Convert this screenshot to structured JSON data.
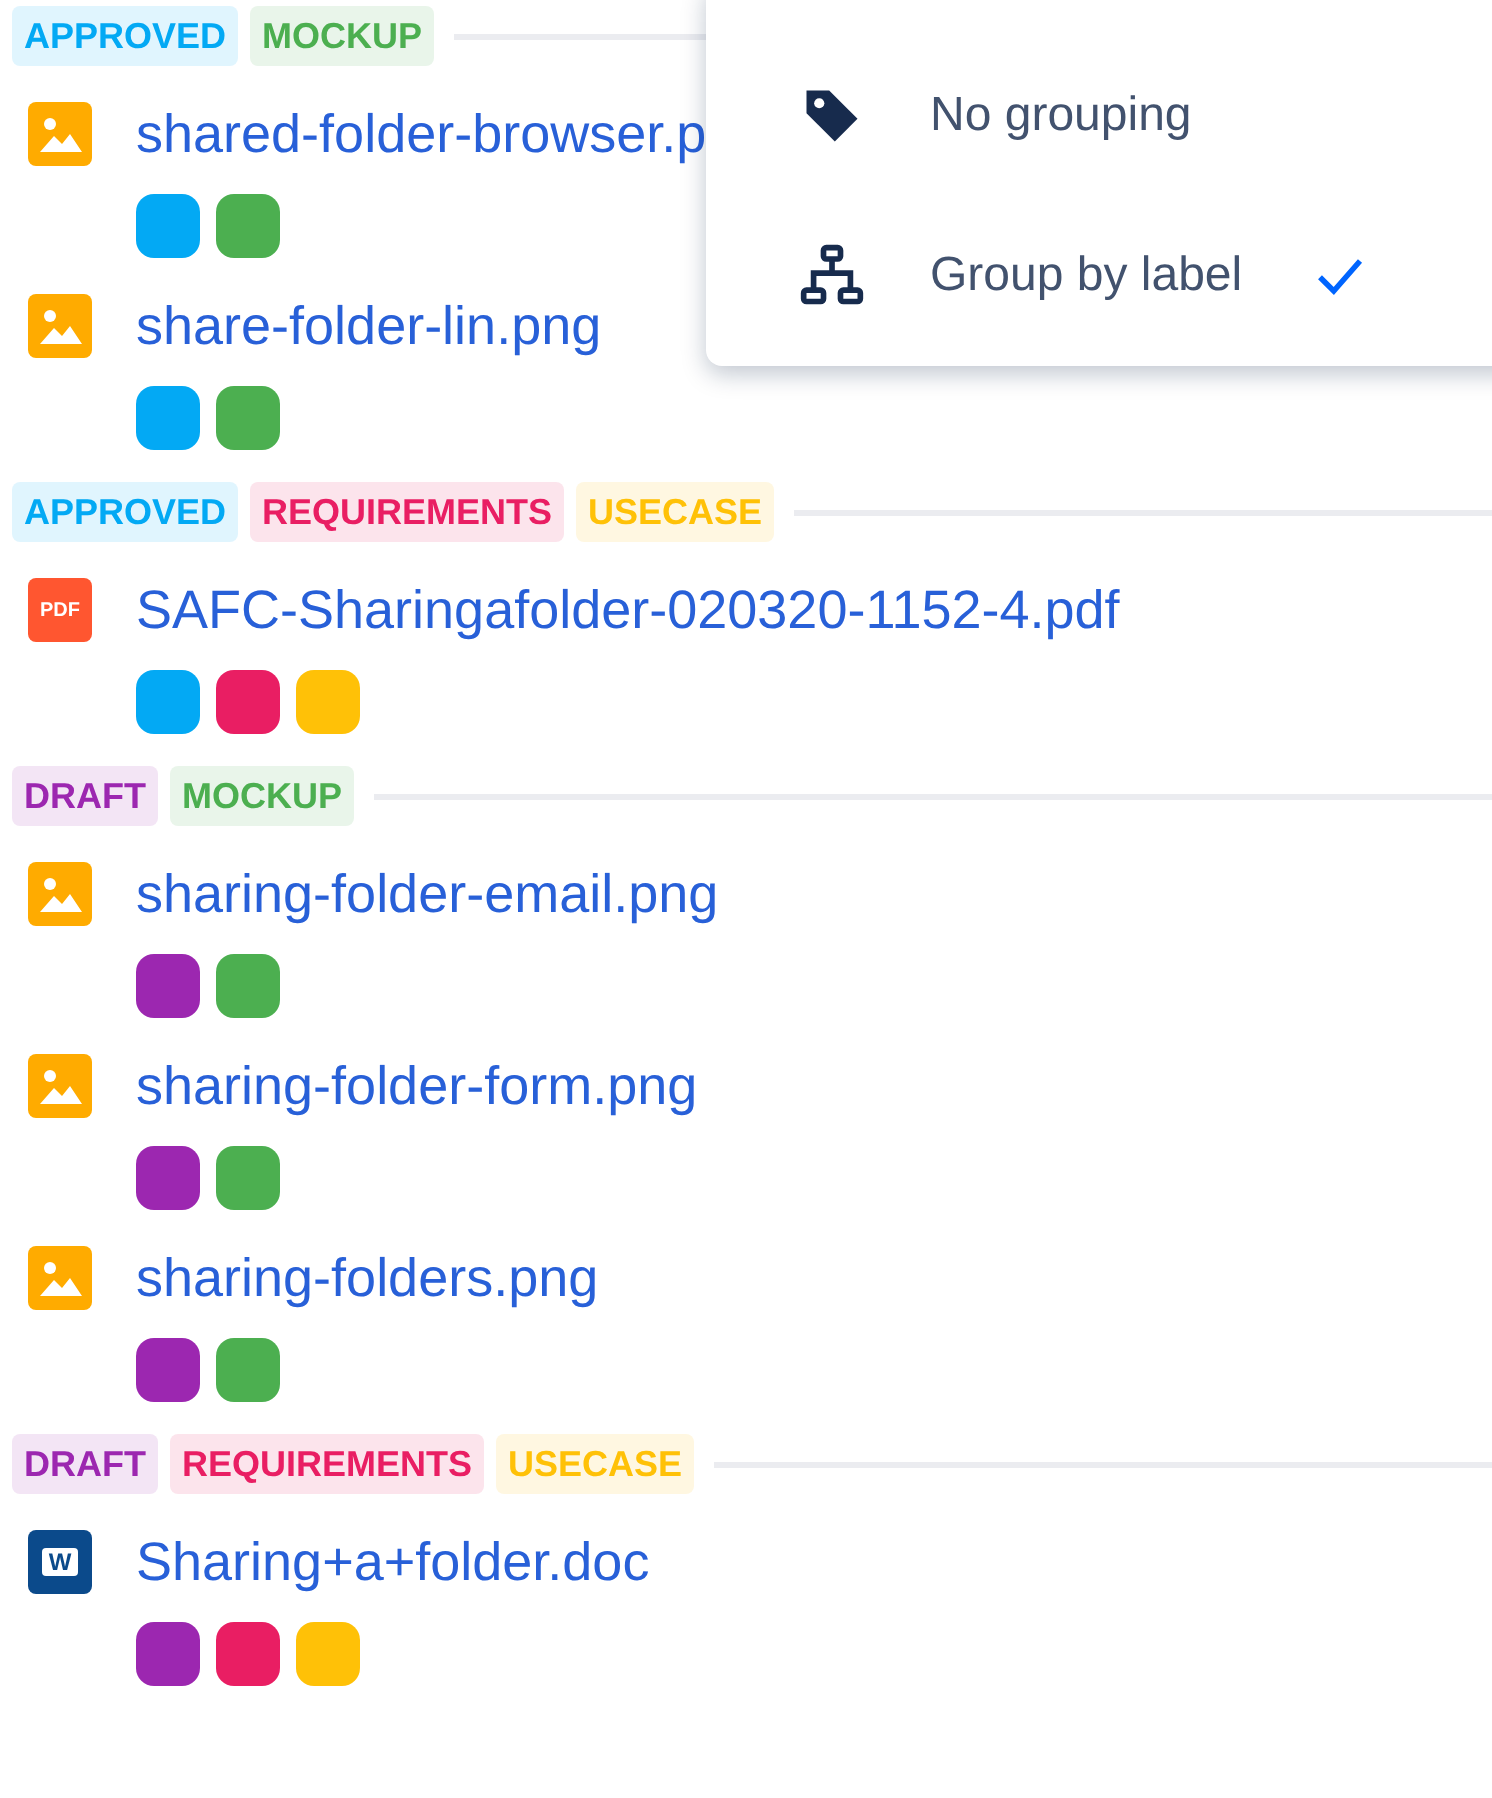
{
  "groups": [
    {
      "labels": [
        {
          "text": "APPROVED",
          "color": "#03a9f4"
        },
        {
          "text": "MOCKUP",
          "color": "#4caf50"
        }
      ],
      "files": [
        {
          "kind": "image",
          "name": "shared-folder-browser.p",
          "tags": [
            {
              "color": "#03a9f4"
            },
            {
              "color": "#4caf50"
            }
          ]
        },
        {
          "kind": "image",
          "name": "share-folder-lin.png",
          "tags": [
            {
              "color": "#03a9f4"
            },
            {
              "color": "#4caf50"
            }
          ]
        }
      ]
    },
    {
      "labels": [
        {
          "text": "APPROVED",
          "color": "#03a9f4"
        },
        {
          "text": "REQUIREMENTS",
          "color": "#e91e63"
        },
        {
          "text": "USECASE",
          "color": "#ffc107"
        }
      ],
      "files": [
        {
          "kind": "pdf",
          "icon_text": "PDF",
          "name": "SAFC-Sharingafolder-020320-1152-4.pdf",
          "tags": [
            {
              "color": "#03a9f4"
            },
            {
              "color": "#e91e63"
            },
            {
              "color": "#ffc107"
            }
          ]
        }
      ]
    },
    {
      "labels": [
        {
          "text": "DRAFT",
          "color": "#9c27b0"
        },
        {
          "text": "MOCKUP",
          "color": "#4caf50"
        }
      ],
      "files": [
        {
          "kind": "image",
          "name": "sharing-folder-email.png",
          "tags": [
            {
              "color": "#9c27b0"
            },
            {
              "color": "#4caf50"
            }
          ]
        },
        {
          "kind": "image",
          "name": "sharing-folder-form.png",
          "tags": [
            {
              "color": "#9c27b0"
            },
            {
              "color": "#4caf50"
            }
          ]
        },
        {
          "kind": "image",
          "name": "sharing-folders.png",
          "tags": [
            {
              "color": "#9c27b0"
            },
            {
              "color": "#4caf50"
            }
          ]
        }
      ]
    },
    {
      "labels": [
        {
          "text": "DRAFT",
          "color": "#9c27b0"
        },
        {
          "text": "REQUIREMENTS",
          "color": "#e91e63"
        },
        {
          "text": "USECASE",
          "color": "#ffc107"
        }
      ],
      "files": [
        {
          "kind": "doc",
          "icon_text": "W",
          "name": "Sharing+a+folder.doc",
          "tags": [
            {
              "color": "#9c27b0"
            },
            {
              "color": "#e91e63"
            },
            {
              "color": "#ffc107"
            }
          ]
        }
      ]
    }
  ],
  "menu": {
    "items": [
      {
        "kind": "tag",
        "label": "No grouping",
        "selected": false
      },
      {
        "kind": "tree",
        "label": "Group by label",
        "selected": true
      }
    ]
  }
}
